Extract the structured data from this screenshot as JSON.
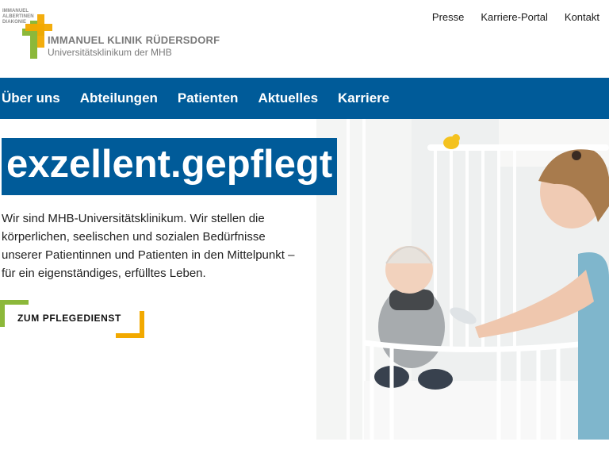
{
  "header": {
    "logo_small_lines": [
      "IMMANUEL",
      "ALBERTINEN",
      "DIAKONIE"
    ],
    "brand_name": "IMMANUEL KLINIK RÜDERSDORF",
    "brand_sub": "Universitätsklinikum der MHB",
    "topnav": [
      "Presse",
      "Karriere-Portal",
      "Kontakt"
    ]
  },
  "mainnav": [
    "Über uns",
    "Abteilungen",
    "Patienten",
    "Aktuelles",
    "Karriere"
  ],
  "hero": {
    "headline": "exzellent.gepflegt",
    "intro": "Wir sind MHB-Universitätsklinikum. Wir stellen die körperlichen, seelischen und sozialen Bedürfnisse unserer Patientinnen und Patienten in den Mittelpunkt – für ein eigenständiges, erfülltes Leben.",
    "cta_label": "ZUM PFLEGEDIENST"
  },
  "colors": {
    "primary_blue": "#005b99",
    "cross_green": "#8cb83a",
    "cross_orange": "#f2a900"
  }
}
